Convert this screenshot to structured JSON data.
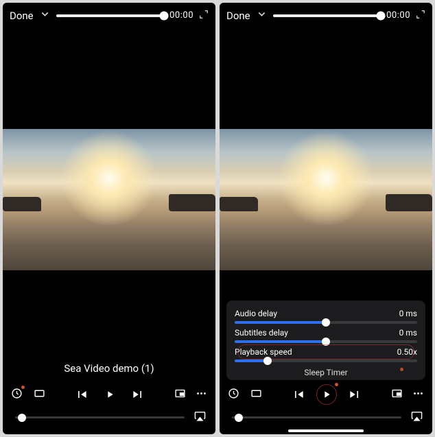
{
  "left": {
    "header": {
      "done": "Done",
      "time": "00:00"
    },
    "title": "Sea Video demo (1)"
  },
  "right": {
    "header": {
      "done": "Done",
      "time": "00:00"
    },
    "panel": {
      "audio_label": "Audio delay",
      "audio_value": "0 ms",
      "subs_label": "Subtitles delay",
      "subs_value": "0 ms",
      "speed_label": "Playback speed",
      "speed_value": "0.50x",
      "sleep_label": "Sleep Timer"
    }
  },
  "chart_data": null
}
